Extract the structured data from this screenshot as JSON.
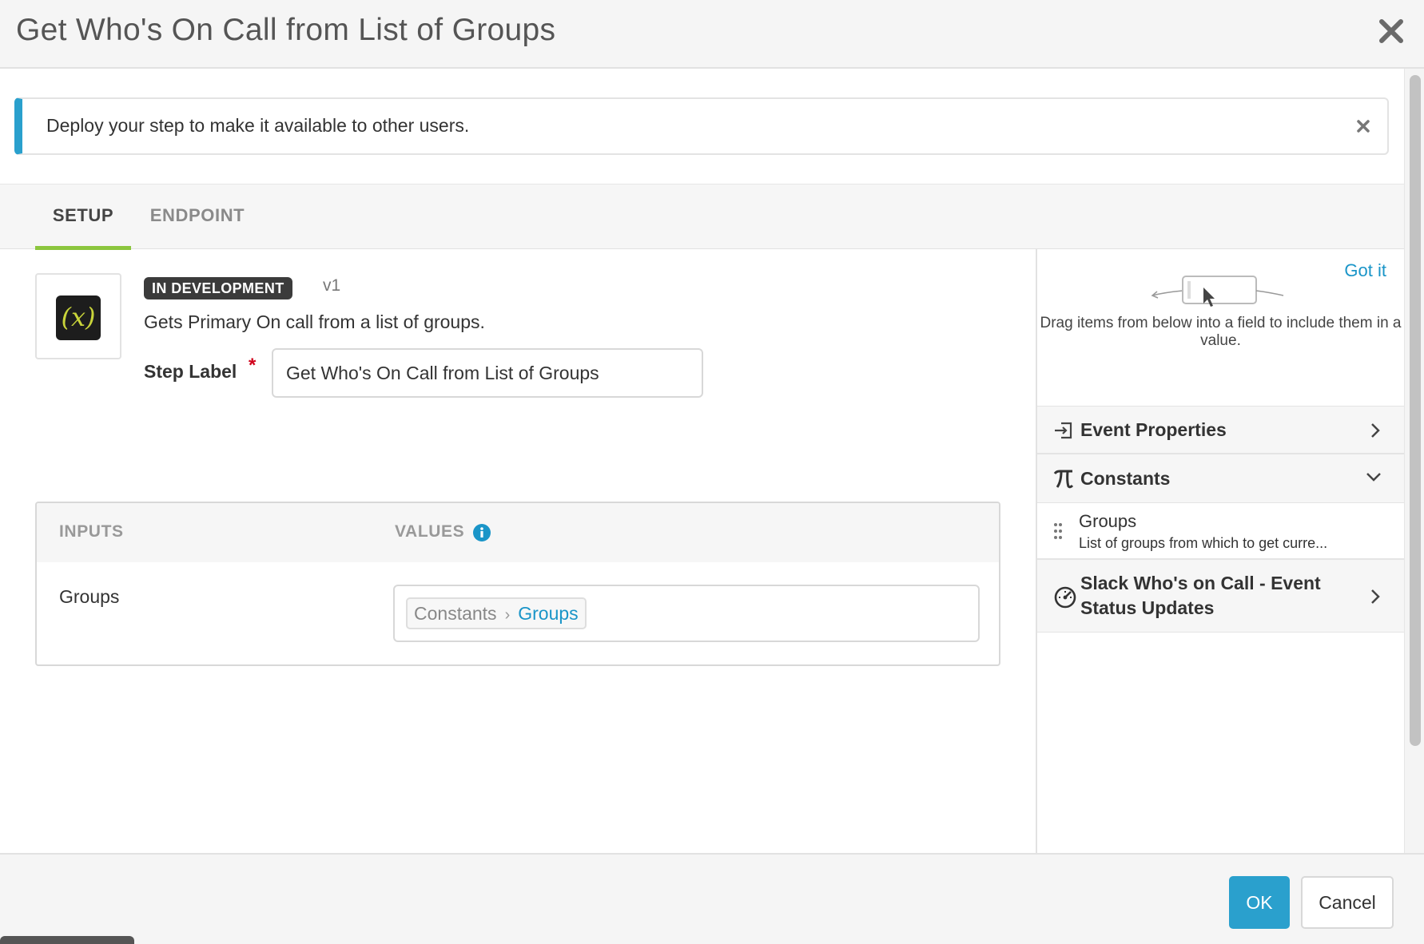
{
  "modal": {
    "title": "Get Who's On Call from List of Groups",
    "close_icon": "close-icon"
  },
  "notice": {
    "text": "Deploy your step to make it available to other users.",
    "accent_color": "#2aa0cd"
  },
  "tabs": [
    {
      "label": "SETUP",
      "active": true
    },
    {
      "label": "ENDPOINT",
      "active": false
    }
  ],
  "step": {
    "status_badge": "IN DEVELOPMENT",
    "version": "v1",
    "description": "Gets Primary On call from a list of groups.",
    "label_caption": "Step Label",
    "required_marker": "*",
    "label_value": "Get Who's On Call from List of Groups",
    "icon_glyph": "(x)"
  },
  "inputs_table": {
    "col_inputs": "INPUTS",
    "col_values": "VALUES",
    "rows": [
      {
        "input": "Groups",
        "value_prefix": "Constants",
        "value_separator": "›",
        "value_name": "Groups"
      }
    ]
  },
  "side_panel": {
    "got_it": "Got it",
    "hint": "Drag items from below into a field to include them in a value.",
    "sections": [
      {
        "title": "Event Properties",
        "icon": "event-properties-icon",
        "expanded": false
      },
      {
        "title": "Constants",
        "icon": "pi-icon",
        "expanded": true
      },
      {
        "title": "Slack Who's on Call - Event Status Updates",
        "icon": "gauge-icon",
        "expanded": false
      }
    ],
    "constants": [
      {
        "name": "Groups",
        "description": "List of groups from which to get curre..."
      }
    ]
  },
  "footer": {
    "ok_label": "OK",
    "cancel_label": "Cancel",
    "primary_color": "#2aa0cd"
  },
  "colors": {
    "accent_green": "#8cc63e",
    "link_blue": "#1a95c8",
    "required_red": "#d0021b"
  }
}
